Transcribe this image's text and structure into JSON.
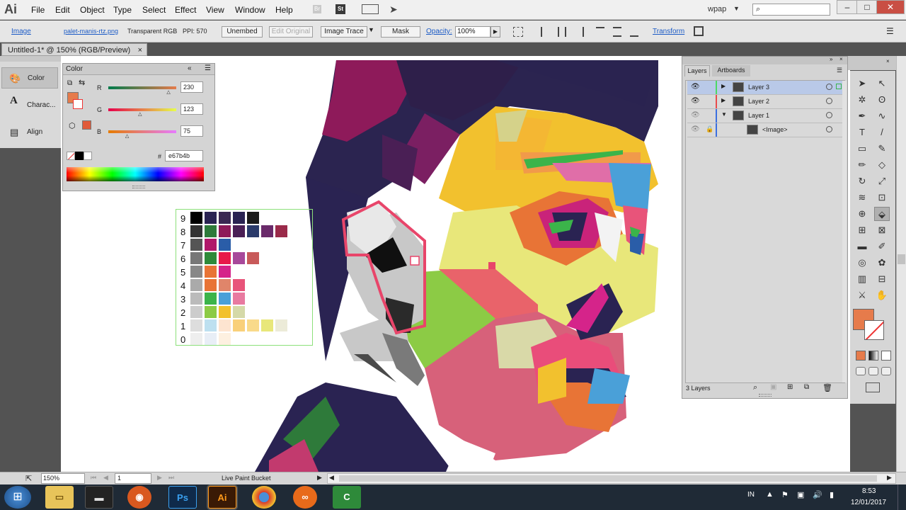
{
  "app": {
    "logo": "Ai",
    "workspace": "wpap",
    "search_placeholder": ""
  },
  "menu": [
    "File",
    "Edit",
    "Object",
    "Type",
    "Select",
    "Effect",
    "View",
    "Window",
    "Help"
  ],
  "menu_icons": {
    "bridge": "Br",
    "stock": "St"
  },
  "control": {
    "selection": "Image",
    "file": "palet-manis-rtz.png",
    "color_mode": "Transparent RGB",
    "ppi": "PPI: 570",
    "unembed": "Unembed",
    "edit_original": "Edit Original",
    "image_trace": "Image Trace",
    "mask": "Mask",
    "opacity_label": "Opacity:",
    "opacity_value": "100%",
    "transform": "Transform"
  },
  "document_tab": "Untitled-1* @ 150% (RGB/Preview)",
  "left_dock": [
    {
      "label": "Color"
    },
    {
      "label": "Charac..."
    },
    {
      "label": "Align"
    }
  ],
  "color_panel": {
    "title": "Color",
    "r_label": "R",
    "r_value": "230",
    "r_fraction": 0.9,
    "g_label": "G",
    "g_value": "123",
    "g_fraction": 0.48,
    "b_label": "B",
    "b_value": "75",
    "b_fraction": 0.29,
    "hash": "#",
    "hex": "e67b4b",
    "fill_color": "#e67b4b"
  },
  "swatch_rows": [
    "9",
    "8",
    "7",
    "6",
    "5",
    "4",
    "3",
    "2",
    "1",
    "0"
  ],
  "layers_panel": {
    "tabs": [
      "Layers",
      "Artboards"
    ],
    "rows": [
      {
        "name": "Layer 3",
        "color": "#4cd964",
        "selected": true
      },
      {
        "name": "Layer 2",
        "color": "#e84c4c",
        "selected": false
      },
      {
        "name": "Layer 1",
        "color": "#3b6fe0",
        "selected": false
      },
      {
        "name": "<Image>",
        "color": "#3b6fe0",
        "selected": false
      }
    ],
    "footer": "3 Layers"
  },
  "status": {
    "zoom": "150%",
    "artboard": "1",
    "tool": "Live Paint Bucket"
  },
  "taskbar": {
    "lang": "IN",
    "time": "8:53",
    "date": "12/01/2017"
  },
  "colors": {
    "fill": "#e67b4b",
    "accent": "#3b6fe0"
  }
}
